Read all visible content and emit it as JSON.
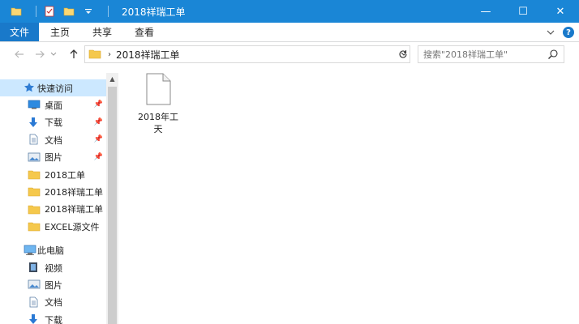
{
  "window": {
    "title": "2018祥瑞工单",
    "controls": {
      "minimize": "—",
      "maximize": "☐",
      "close": "✕"
    }
  },
  "ribbon": {
    "tabs": [
      "文件",
      "主页",
      "共享",
      "查看"
    ],
    "help": "?"
  },
  "address": {
    "path": "2018祥瑞工单",
    "search_placeholder": "搜索\"2018祥瑞工单\""
  },
  "nav": {
    "quick_access": {
      "label": "快速访问",
      "items": [
        {
          "label": "桌面",
          "icon": "desktop-icon",
          "pinned": true
        },
        {
          "label": "下载",
          "icon": "download-icon",
          "pinned": true
        },
        {
          "label": "文档",
          "icon": "document-icon",
          "pinned": true
        },
        {
          "label": "图片",
          "icon": "pictures-icon",
          "pinned": true
        },
        {
          "label": "2018工单",
          "icon": "folder-icon",
          "pinned": false
        },
        {
          "label": "2018祥瑞工单",
          "icon": "folder-icon",
          "pinned": false
        },
        {
          "label": "2018祥瑞工单",
          "icon": "folder-icon",
          "pinned": false
        },
        {
          "label": "EXCEL源文件",
          "icon": "folder-icon",
          "pinned": false
        }
      ]
    },
    "this_pc": {
      "label": "此电脑",
      "items": [
        {
          "label": "视频",
          "icon": "videos-icon"
        },
        {
          "label": "图片",
          "icon": "pictures-icon"
        },
        {
          "label": "文档",
          "icon": "document-icon"
        },
        {
          "label": "下载",
          "icon": "download-icon"
        }
      ]
    }
  },
  "files": [
    {
      "name": "2018年工天",
      "icon": "blank-file-icon"
    }
  ],
  "colors": {
    "titlebar": "#1a86d6",
    "file_tab": "#1979ca",
    "selection": "#cce8ff",
    "folder": "#f5c84c"
  }
}
